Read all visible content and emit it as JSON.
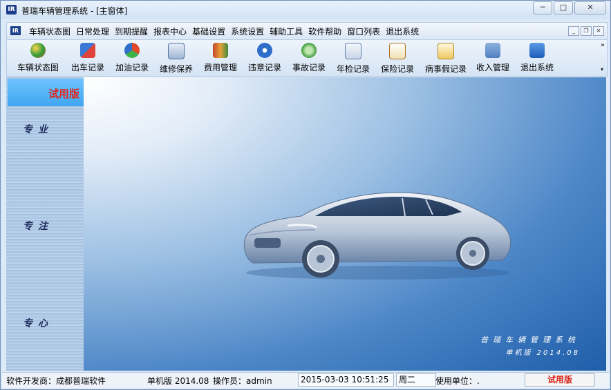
{
  "window": {
    "title": "普瑞车辆管理系统 - [主窗体]",
    "app_icon": "IR",
    "controls": {
      "minimize": "─",
      "maximize": "□",
      "close": "✕"
    }
  },
  "menubar": {
    "icon": "IR",
    "items": [
      "车辆状态图",
      "日常处理",
      "到期提醒",
      "报表中心",
      "基础设置",
      "系统设置",
      "辅助工具",
      "软件帮助",
      "窗口列表",
      "退出系统"
    ],
    "mdi_controls": {
      "minimize": "_",
      "restore": "❐",
      "close": "✕"
    }
  },
  "toolbar": {
    "items": [
      {
        "label": "车辆状态图",
        "icon": "vehicle-status-icon"
      },
      {
        "label": "出车记录",
        "icon": "dispatch-icon"
      },
      {
        "label": "加油记录",
        "icon": "fuel-icon"
      },
      {
        "label": "维修保养",
        "icon": "maintenance-icon"
      },
      {
        "label": "费用管理",
        "icon": "expense-icon"
      },
      {
        "label": "违章记录",
        "icon": "violation-icon"
      },
      {
        "label": "事故记录",
        "icon": "accident-icon"
      },
      {
        "label": "年检记录",
        "icon": "inspection-icon"
      },
      {
        "label": "保险记录",
        "icon": "insurance-icon"
      },
      {
        "label": "病事假记录",
        "icon": "leave-icon"
      },
      {
        "label": "收入管理",
        "icon": "income-icon"
      },
      {
        "label": "退出系统",
        "icon": "exit-icon"
      }
    ],
    "overflow": "»",
    "dropdown": "▾"
  },
  "sidebar": {
    "trial_label": "试用版",
    "words": [
      "专业",
      "专注",
      "专心"
    ]
  },
  "brand": {
    "name": "普瑞车辆管理系统",
    "edition": "单机版 2014.08"
  },
  "statusbar": {
    "developer": "软件开发商：成都普瑞软件",
    "version": "单机版 2014.08",
    "operator": "操作员：admin",
    "datetime": "2015-03-03 10:51:25",
    "weekday": "周二",
    "unit": "使用单位：.",
    "trial": "试用版"
  }
}
